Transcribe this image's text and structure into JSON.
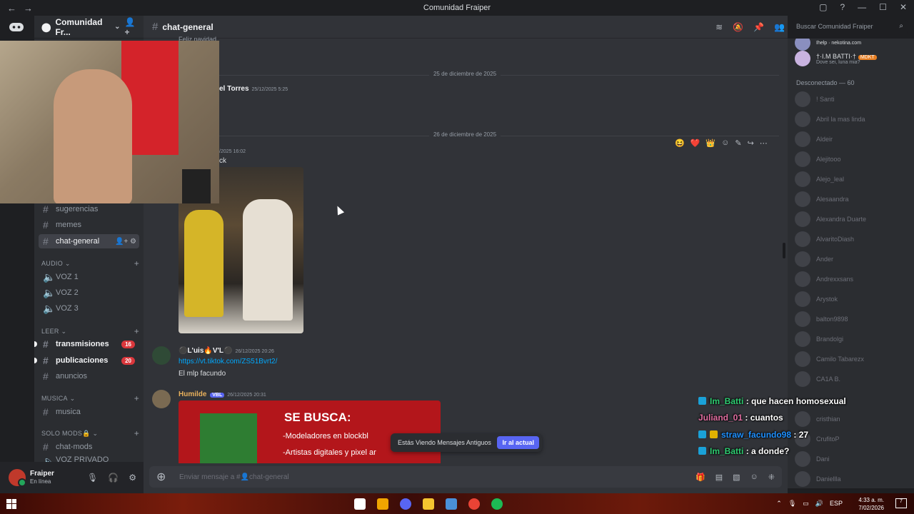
{
  "titlebar": {
    "title": "Comunidad Fraiper",
    "back": "←",
    "forward": "→"
  },
  "server": {
    "name": "Comunidad Fr..."
  },
  "channels": {
    "sugerencias": "sugerencias",
    "memes": "memes",
    "chat_general": "chat-general",
    "audio_category": "AUDIO",
    "voz1": "VOZ 1",
    "voz2": "VOZ 2",
    "voz3": "VOZ 3",
    "leer_category": "LEER",
    "transmisiones": "transmisiones",
    "transmisiones_badge": "16",
    "publicaciones": "publicaciones",
    "publicaciones_badge": "20",
    "anuncios": "anuncios",
    "musica_category": "MUSICA",
    "musica": "musica",
    "solomods_category": "SOLO MODS🔒",
    "chat_mods": "chat-mods",
    "voz_privado": "VOZ PRIVADO"
  },
  "user": {
    "name": "Fraiper",
    "status": "En línea"
  },
  "chat": {
    "channel_name": "chat-general",
    "partial_top": "Feliz navidad",
    "divider1": "25 de diciembre de 2025",
    "msg1_author": "el Torres",
    "msg1_time": "25/12/2025 5:25",
    "divider2": "26 de diciembre de 2025",
    "msg2_time": "/2025 16:02",
    "msg2_text": "ck",
    "msg3_author": "⚫L'uis🔥V'L⚫",
    "msg3_time": "26/12/2025 20:26",
    "msg3_link": "https://vt.tiktok.com/ZS51Bvrt2/",
    "msg3_text": "El mlp facundo",
    "msg4_author": "Humilde",
    "msg4_tag": "VBL",
    "msg4_time": "26/12/2025 20:31",
    "banner_title": "SE BUSCA:",
    "banner_line1": "-Modeladores en blockbl",
    "banner_line2": "-Artistas digitales y pixel ar",
    "jump_text": "Estás Viendo Mensajes Antiguos",
    "jump_button": "Ir al actual",
    "composer_placeholder": "Enviar mensaje a #👤chat-general"
  },
  "search": {
    "placeholder": "Buscar Comunidad Fraiper"
  },
  "members": {
    "top_partial": "Ihelp · nekotina.com",
    "online_member": "†·I.M BATTI·†",
    "online_tag": "MDKT",
    "online_status": "Dove sei, luna mia?",
    "offline_header": "Desconectado — 60",
    "offline": [
      "! Santi",
      "Abril la mas linda",
      "Aldeir",
      "Alejitooo",
      "Alejo_leal",
      "Alesaandra",
      "Alexandra Duarte",
      "AlvaritoDiash",
      "Ander",
      "Andrexxsans",
      "Arystok",
      "balton9898",
      "Brandolgi",
      "Camilo Tabarezx",
      "CA1A B.",
      "cristhian",
      "CrufitoP",
      "Dani",
      "Daniellla"
    ]
  },
  "stream_chat": [
    {
      "user": "Im_Batti",
      "text": ": que hacen homosexual",
      "color": "#2ecc71"
    },
    {
      "user": "Juliand_01",
      "text": ": cuantos",
      "color": "#e06c9f"
    },
    {
      "user": "straw_facundo98",
      "text": ": 27",
      "color": "#1e90ff"
    },
    {
      "user": "Im_Batti",
      "text": ": a donde?",
      "color": "#2ecc71"
    }
  ],
  "taskbar": {
    "lang": "ESP",
    "time": "4:33 a. m.",
    "date": "7/02/2026",
    "notif_count": "7"
  },
  "colors": {
    "accent": "#5865f2",
    "online": "#23a55a",
    "badge": "#da373c"
  },
  "icons": [
    "discord-icon",
    "settings-icon",
    "mic-icon",
    "headphones-icon",
    "pin-icon",
    "members-icon",
    "search-icon",
    "plus-icon",
    "gift-icon",
    "emoji-icon"
  ]
}
